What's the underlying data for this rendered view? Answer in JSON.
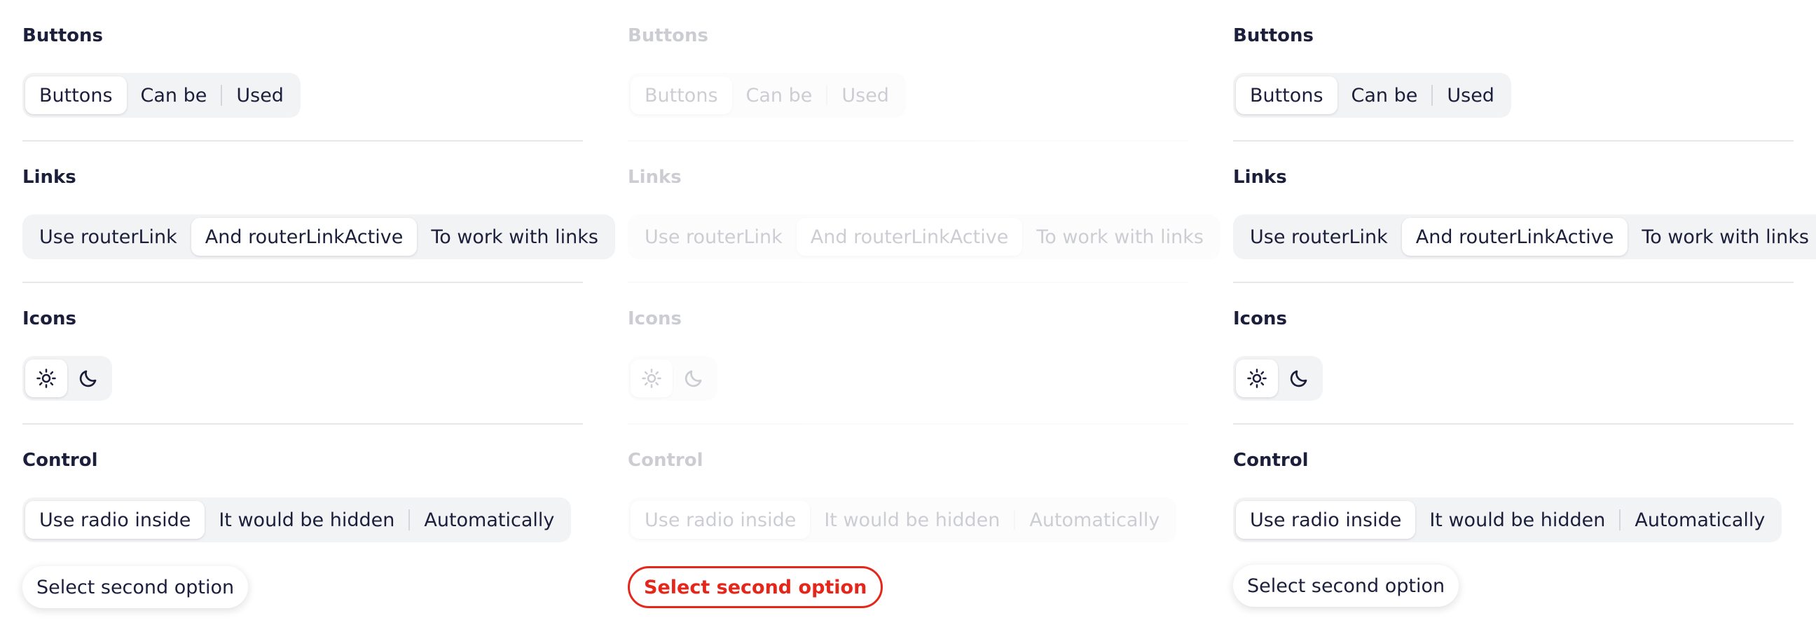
{
  "panels": [
    {
      "state": "default",
      "buttons": {
        "title": "Buttons",
        "items": [
          "Buttons",
          "Can be",
          "Used"
        ],
        "active_index": 0
      },
      "links": {
        "title": "Links",
        "items": [
          "Use routerLink",
          "And routerLinkActive",
          "To work with links"
        ],
        "active_index": 1
      },
      "icons": {
        "title": "Icons",
        "items": [
          "sun-icon",
          "moon-icon"
        ],
        "active_index": 0
      },
      "control": {
        "title": "Control",
        "items": [
          "Use radio inside",
          "It would be hidden",
          "Automatically"
        ],
        "active_index": 0,
        "select_label": "Select second option"
      }
    },
    {
      "state": "disabled",
      "buttons": {
        "title": "Buttons",
        "items": [
          "Buttons",
          "Can be",
          "Used"
        ],
        "active_index": 0
      },
      "links": {
        "title": "Links",
        "items": [
          "Use routerLink",
          "And routerLinkActive",
          "To work with links"
        ],
        "active_index": 1
      },
      "icons": {
        "title": "Icons",
        "items": [
          "sun-icon",
          "moon-icon"
        ],
        "active_index": 0
      },
      "control": {
        "title": "Control",
        "items": [
          "Use radio inside",
          "It would be hidden",
          "Automatically"
        ],
        "active_index": 0,
        "select_label": "Select second option"
      }
    },
    {
      "state": "default",
      "buttons": {
        "title": "Buttons",
        "items": [
          "Buttons",
          "Can be",
          "Used"
        ],
        "active_index": 0
      },
      "links": {
        "title": "Links",
        "items": [
          "Use routerLink",
          "And routerLinkActive",
          "To work with links"
        ],
        "active_index": 1
      },
      "icons": {
        "title": "Icons",
        "items": [
          "sun-icon",
          "moon-icon"
        ],
        "active_index": 0
      },
      "control": {
        "title": "Control",
        "items": [
          "Use radio inside",
          "It would be hidden",
          "Automatically"
        ],
        "active_index": 0,
        "select_label": "Select second option"
      }
    }
  ],
  "colors": {
    "text": "#1b1f3b",
    "segment_bg": "#f2f3f5",
    "divider": "#e6e8ec",
    "focus_red": "#e5261b"
  }
}
